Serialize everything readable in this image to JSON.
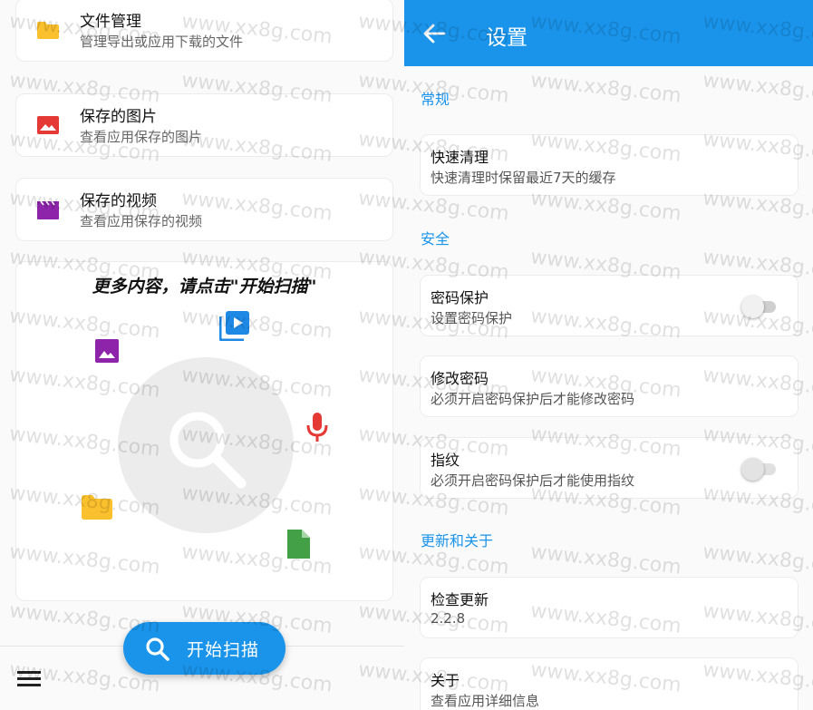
{
  "left": {
    "cards": [
      {
        "title": "文件管理",
        "subtitle": "管理导出或应用下载的文件",
        "icon": "folder-icon",
        "color": "#fbc02d"
      },
      {
        "title": "保存的图片",
        "subtitle": "查看应用保存的图片",
        "icon": "image-icon",
        "color": "#e53935"
      },
      {
        "title": "保存的视频",
        "subtitle": "查看应用保存的视频",
        "icon": "video-icon",
        "color": "#8e24aa"
      }
    ],
    "scan_hint": "更多内容，请点击\"开始扫描\"",
    "scan_button": "开始扫描"
  },
  "settings": {
    "title": "设置",
    "sections": [
      {
        "label": "常规"
      },
      {
        "label": "安全"
      },
      {
        "label": "更新和关于"
      }
    ],
    "items": [
      {
        "title": "快速清理",
        "subtitle": "快速清理时保留最近7天的缓存"
      },
      {
        "title": "密码保护",
        "subtitle": "设置密码保护",
        "toggle": false
      },
      {
        "title": "修改密码",
        "subtitle": "必须开启密码保护后才能修改密码"
      },
      {
        "title": "指纹",
        "subtitle": "必须开启密码保护后才能使用指纹",
        "toggle": false
      },
      {
        "title": "检查更新",
        "subtitle": "2.2.8"
      },
      {
        "title": "关于",
        "subtitle": "查看应用详细信息"
      }
    ]
  },
  "watermark": "www.xx8g.com",
  "colors": {
    "accent": "#1a94ea"
  }
}
